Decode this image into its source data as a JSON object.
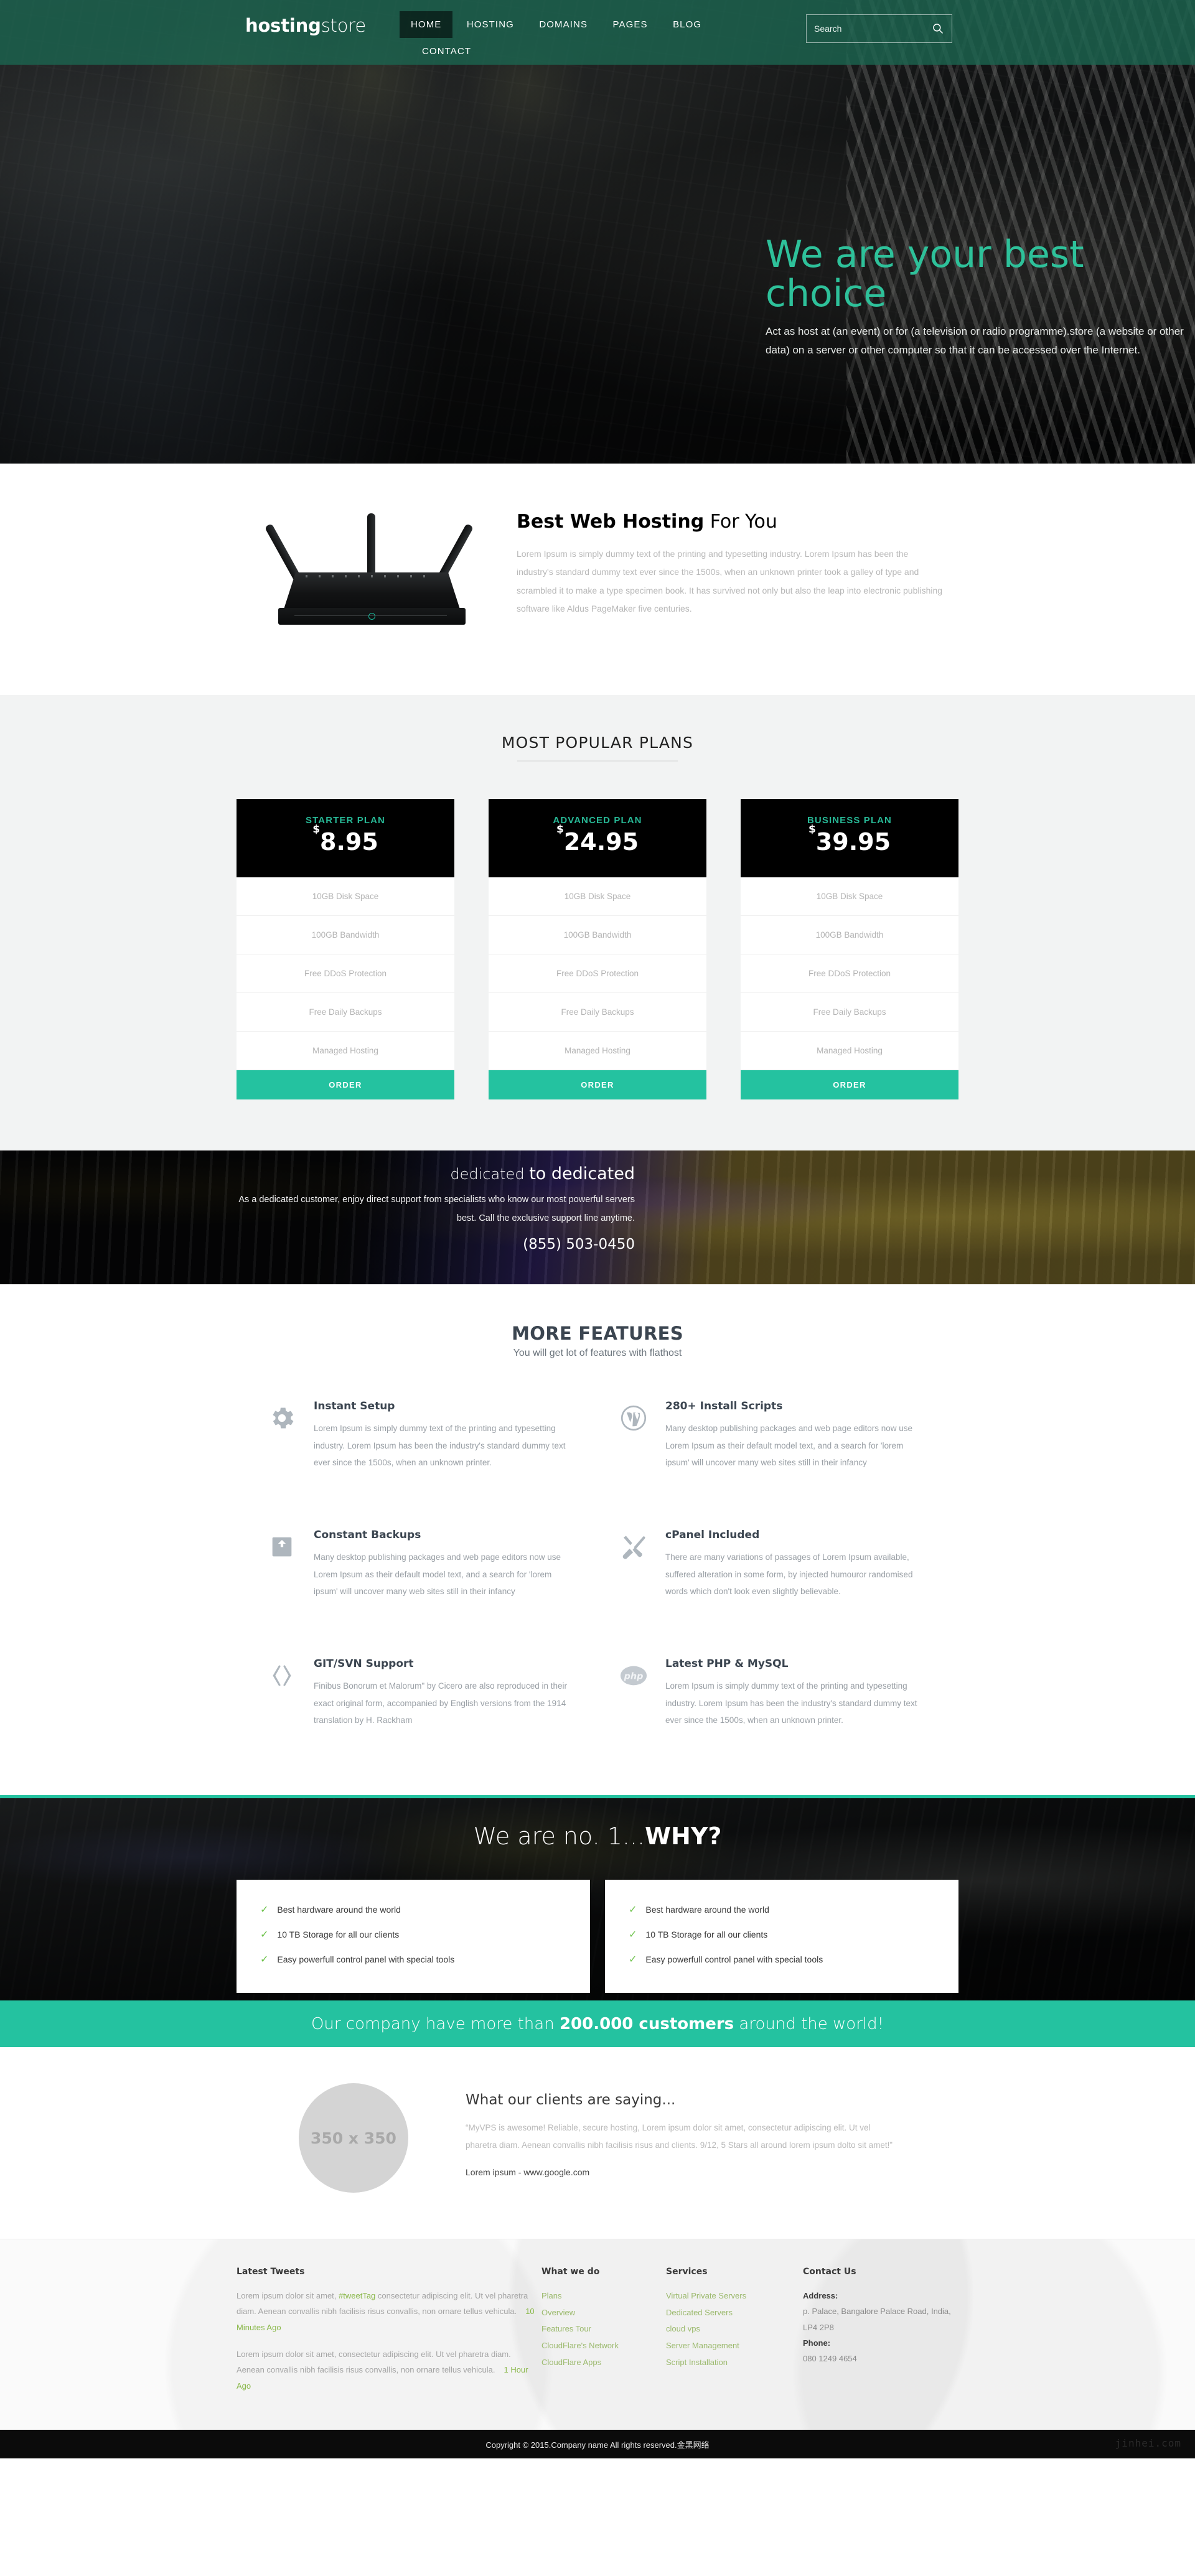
{
  "header": {
    "logo_bold": "hosting",
    "logo_light": "store",
    "nav": [
      {
        "label": "HOME",
        "active": true
      },
      {
        "label": "HOSTING",
        "active": false
      },
      {
        "label": "DOMAINS",
        "active": false
      },
      {
        "label": "PAGES",
        "active": false
      },
      {
        "label": "BLOG",
        "active": false
      },
      {
        "label": "CONTACT",
        "active": false
      }
    ],
    "search_placeholder": "Search",
    "search_value": ""
  },
  "hero": {
    "title": "We are your best choice",
    "subtitle": "Act as host at (an event) or for (a television or radio programme).store (a website or other data) on a server or other computer so that it can be accessed over the Internet."
  },
  "intro": {
    "heading_bold": "Best Web Hosting",
    "heading_light": " For You",
    "body": "Lorem Ipsum is simply dummy text of the printing and typesetting industry. Lorem Ipsum has been the industry's standard dummy text ever since the 1500s, when an unknown printer took a galley of type and scrambled it to make a type specimen book. It has survived not only but also the leap into electronic publishing software like Aldus PageMaker five centuries."
  },
  "plans": {
    "title": "MOST POPULAR PLANS",
    "order_label": "ORDER",
    "items": [
      {
        "name": "STARTER PLAN",
        "currency": "$",
        "price": "8.95",
        "features": [
          "10GB Disk Space",
          "100GB Bandwidth",
          "Free DDoS Protection",
          "Free Daily Backups",
          "Managed Hosting"
        ]
      },
      {
        "name": "ADVANCED PLAN",
        "currency": "$",
        "price": "24.95",
        "features": [
          "10GB Disk Space",
          "100GB Bandwidth",
          "Free DDoS Protection",
          "Free Daily Backups",
          "Managed Hosting"
        ]
      },
      {
        "name": "BUSINESS PLAN",
        "currency": "$",
        "price": "39.95",
        "features": [
          "10GB Disk Space",
          "100GB Bandwidth",
          "Free DDoS Protection",
          "Free Daily Backups",
          "Managed Hosting"
        ]
      }
    ]
  },
  "dedicated": {
    "title_light": "dedicated ",
    "title_bold": "to dedicated",
    "body": "As a dedicated customer, enjoy direct support from specialists who know our most powerful servers best. Call the exclusive support line anytime.",
    "phone": "(855) 503-0450"
  },
  "features": {
    "title": "MORE FEATURES",
    "subtitle": "You will get lot of features with flathost",
    "items": [
      {
        "icon": "gear-icon",
        "title": "Instant Setup",
        "body": "Lorem Ipsum is simply dummy text of the printing and typesetting industry. Lorem Ipsum has been the industry's standard dummy text ever since the 1500s, when an unknown printer."
      },
      {
        "icon": "wordpress-icon",
        "title": "280+ Install Scripts",
        "body": "Many desktop publishing packages and web page editors now use Lorem Ipsum as their default model text, and a search for 'lorem ipsum' will uncover many web sites still in their infancy"
      },
      {
        "icon": "backup-icon",
        "title": "Constant Backups",
        "body": "Many desktop publishing packages and web page editors now use Lorem Ipsum as their default model text, and a search for 'lorem ipsum' will uncover many web sites still in their infancy"
      },
      {
        "icon": "tools-icon",
        "title": "cPanel Included",
        "body": "There are many variations of passages of Lorem Ipsum available, suffered alteration in some form, by injected humouror randomised words which don't look even slightly believable."
      },
      {
        "icon": "code-brackets-icon",
        "title": "GIT/SVN Support",
        "body": "Finibus Bonorum et Malorum\" by Cicero are also reproduced in their exact original form, accompanied by English versions from the 1914 translation by H. Rackham"
      },
      {
        "icon": "php-icon",
        "title": "Latest PHP & MySQL",
        "body": "Lorem Ipsum is simply dummy text of the printing and typesetting industry. Lorem Ipsum has been the industry's standard dummy text ever since the 1500s, when an unknown printer."
      }
    ]
  },
  "why": {
    "title_light": "We are no. 1...",
    "title_bold": "WHY?",
    "cards": [
      [
        "Best hardware around the world",
        "10 TB Storage for all our clients",
        "Easy powerfull control panel with special tools"
      ],
      [
        "Best hardware around the world",
        "10 TB Storage for all our clients",
        "Easy powerfull control panel with special tools"
      ]
    ]
  },
  "customers_bar": {
    "pre": "Our company have more than ",
    "highlight": "200.000 customers",
    "post": " around the world!"
  },
  "testimonial": {
    "avatar_label": "350 x 350",
    "heading": "What our clients are saying...",
    "quote": "“MyVPS is awesome! Reliable, secure hosting, Lorem ipsum dolor sit amet, consectetur adipiscing elit. Ut vel pharetra diam. Aenean convallis nibh facilisis risus and clients. 9/12, 5 Stars all around lorem ipsum dolto sit amet!”",
    "cite": "Lorem ipsum - www.google.com"
  },
  "footer": {
    "tweets_heading": "Latest Tweets",
    "tweets": [
      {
        "pre": "Lorem ipsum dolor sit amet, ",
        "tag": "#tweetTag",
        "post": " consectetur adipiscing elit. Ut vel pharetra diam. Aenean convallis nibh facilisis risus convallis, non ornare tellus vehicula.",
        "ago": "10 Minutes Ago"
      },
      {
        "pre": "Lorem ipsum dolor sit amet, consectetur adipiscing elit. Ut vel pharetra diam. Aenean convallis nibh facilisis risus convallis, non ornare tellus vehicula.",
        "tag": "",
        "post": "",
        "ago": "1 Hour Ago"
      }
    ],
    "what_we_do_heading": "What we do",
    "what_we_do": [
      "Plans",
      "Overview",
      "Features Tour",
      "CloudFlare's Network",
      "CloudFlare Apps"
    ],
    "services_heading": "Services",
    "services": [
      "Virtual Private Servers",
      "Dedicated Servers",
      "cloud vps",
      "Server Management",
      "Script Installation"
    ],
    "contact_heading": "Contact Us",
    "address_label": "Address:",
    "address": "p. Palace, Bangalore Palace Road, India, LP4 2P8",
    "phone_label": "Phone:",
    "phone": "080 1249 4654"
  },
  "copyright": {
    "text": "Copyright © 2015.Company name All rights reserved.金黑网络",
    "watermark": "jinhei.com"
  },
  "colors": {
    "accent": "#24c2a0",
    "header_green": "#1b6550",
    "link_green": "#9cba6e",
    "dark": "#000000"
  }
}
